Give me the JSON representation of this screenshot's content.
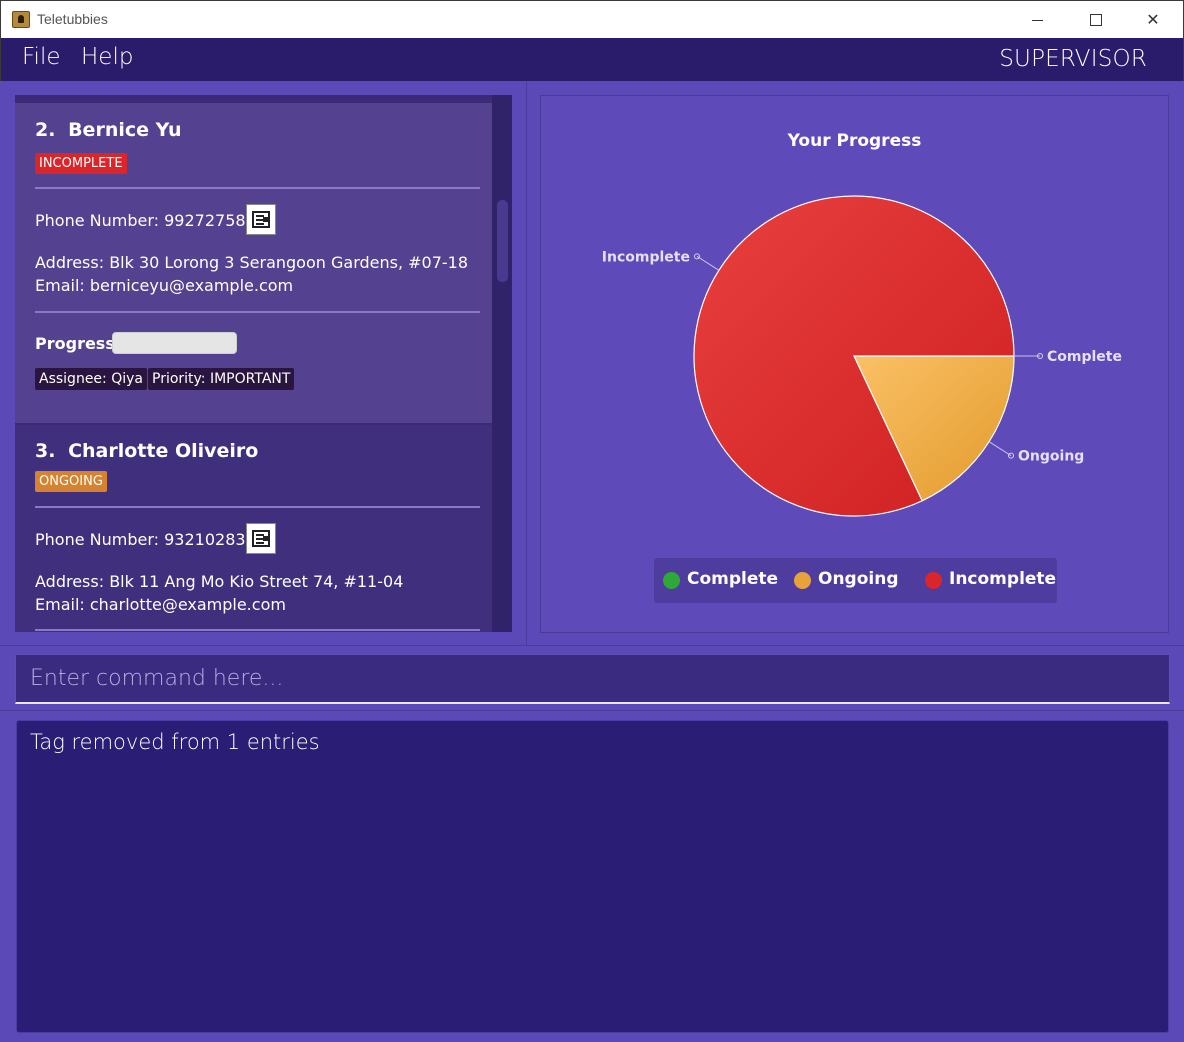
{
  "window": {
    "title": "Teletubbies"
  },
  "menu": {
    "file": "File",
    "help": "Help",
    "role": "SUPERVISOR"
  },
  "persons": [
    {
      "index": "2.",
      "name": "Bernice Yu",
      "status": "INCOMPLETE",
      "phone": "Phone Number: 99272758",
      "address": "Address: Blk 30 Lorong 3 Serangoon Gardens, #07-18",
      "email": "Email: berniceyu@example.com",
      "progress_label": "Progress:",
      "progress": 0,
      "tags": [
        "Assignee: Qiya",
        "Priority: IMPORTANT"
      ]
    },
    {
      "index": "3.",
      "name": "Charlotte Oliveiro",
      "status": "ONGOING",
      "phone": "Phone Number: 93210283",
      "address": "Address: Blk 11 Ang Mo Kio Street 74, #11-04",
      "email": "Email: charlotte@example.com"
    }
  ],
  "chart_data": {
    "type": "pie",
    "title": "Your Progress",
    "categories": [
      "Complete",
      "Ongoing",
      "Incomplete"
    ],
    "values": [
      0,
      18,
      82
    ],
    "colors": [
      "#2fa83a",
      "#e8a23a",
      "#d9262b"
    ],
    "legend": "bottom"
  },
  "command": {
    "placeholder": "Enter command here..."
  },
  "result": {
    "text": "Tag removed from 1 entries"
  }
}
